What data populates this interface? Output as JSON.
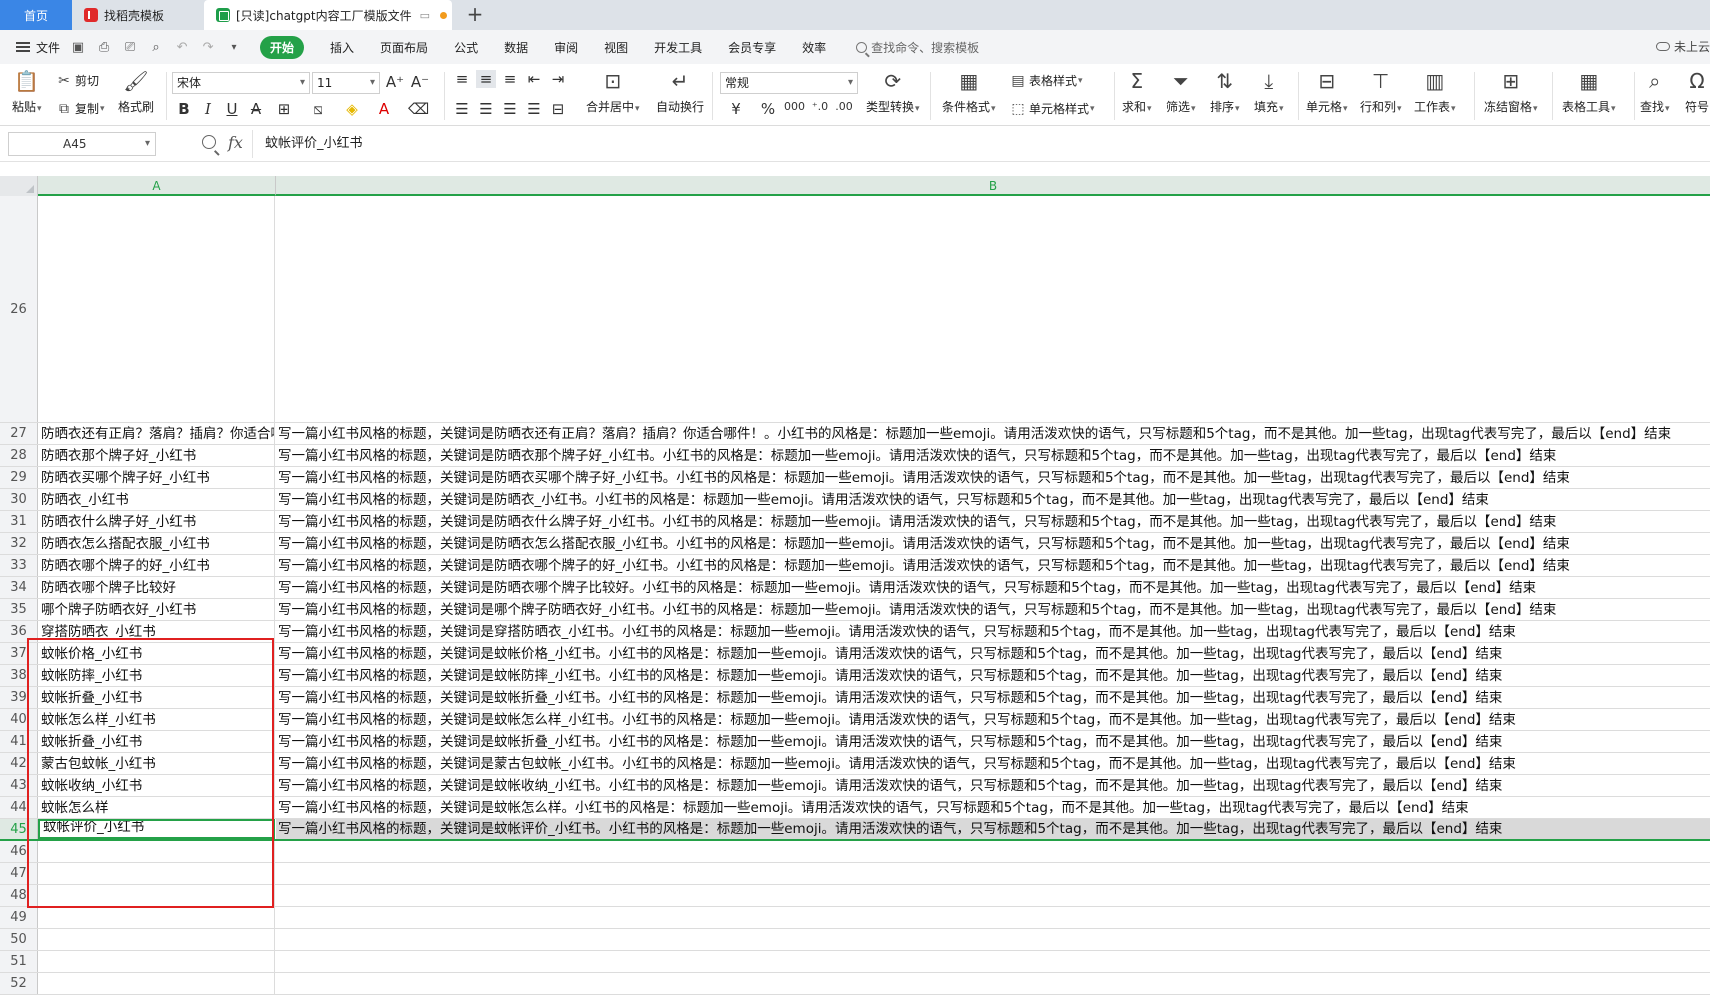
{
  "tabs": {
    "home": "首页",
    "templates": "找稻壳模板",
    "document": "[只读]chatgpt内容工厂模版文件"
  },
  "menu": {
    "file": "文件",
    "start": "开始",
    "items": [
      "插入",
      "页面布局",
      "公式",
      "数据",
      "审阅",
      "视图",
      "开发工具",
      "会员专享",
      "效率"
    ],
    "search": "查找命令、搜索模板",
    "cloud": "未上云"
  },
  "ribbon": {
    "paste": "粘贴",
    "cut": "剪切",
    "copy": "复制",
    "format_painter": "格式刷",
    "font_name": "宋体",
    "font_size": "11",
    "merge": "合并居中",
    "wrap": "自动换行",
    "number_format": "常规",
    "convert": "类型转换",
    "cond_format": "条件格式",
    "table_style": "表格样式",
    "cell_style": "单元格样式",
    "sum": "求和",
    "filter": "筛选",
    "sort": "排序",
    "fill": "填充",
    "cell": "单元格",
    "row_col": "行和列",
    "sheet": "工作表",
    "freeze": "冻结窗格",
    "table_tools": "表格工具",
    "find": "查找",
    "symbol": "符号",
    "currency": "¥",
    "percent": "%"
  },
  "formula_bar": {
    "cell_ref": "A45",
    "content": "蚊帐评价_小红书"
  },
  "columns": [
    "A",
    "B"
  ],
  "rows": [
    {
      "num": "26",
      "a": "",
      "b": ""
    },
    {
      "num": "27",
      "a": "防晒衣还有正肩？落肩？插肩？你适合哪件！_小红书",
      "b": "写一篇小红书风格的标题，关键词是防晒衣还有正肩？落肩？插肩？你适合哪件！。小红书的风格是：标题加一些emoji。请用活泼欢快的语气，只写标题和5个tag，而不是其他。加一些tag，出现tag代表写完了，最后以【end】结束"
    },
    {
      "num": "28",
      "a": "防晒衣那个牌子好_小红书",
      "b": "写一篇小红书风格的标题，关键词是防晒衣那个牌子好_小红书。小红书的风格是：标题加一些emoji。请用活泼欢快的语气，只写标题和5个tag，而不是其他。加一些tag，出现tag代表写完了，最后以【end】结束"
    },
    {
      "num": "29",
      "a": "防晒衣买哪个牌子好_小红书",
      "b": "写一篇小红书风格的标题，关键词是防晒衣买哪个牌子好_小红书。小红书的风格是：标题加一些emoji。请用活泼欢快的语气，只写标题和5个tag，而不是其他。加一些tag，出现tag代表写完了，最后以【end】结束"
    },
    {
      "num": "30",
      "a": "防晒衣_小红书",
      "b": "写一篇小红书风格的标题，关键词是防晒衣_小红书。小红书的风格是：标题加一些emoji。请用活泼欢快的语气，只写标题和5个tag，而不是其他。加一些tag，出现tag代表写完了，最后以【end】结束"
    },
    {
      "num": "31",
      "a": "防晒衣什么牌子好_小红书",
      "b": "写一篇小红书风格的标题，关键词是防晒衣什么牌子好_小红书。小红书的风格是：标题加一些emoji。请用活泼欢快的语气，只写标题和5个tag，而不是其他。加一些tag，出现tag代表写完了，最后以【end】结束"
    },
    {
      "num": "32",
      "a": "防晒衣怎么搭配衣服_小红书",
      "b": "写一篇小红书风格的标题，关键词是防晒衣怎么搭配衣服_小红书。小红书的风格是：标题加一些emoji。请用活泼欢快的语气，只写标题和5个tag，而不是其他。加一些tag，出现tag代表写完了，最后以【end】结束"
    },
    {
      "num": "33",
      "a": "防晒衣哪个牌子的好_小红书",
      "b": "写一篇小红书风格的标题，关键词是防晒衣哪个牌子的好_小红书。小红书的风格是：标题加一些emoji。请用活泼欢快的语气，只写标题和5个tag，而不是其他。加一些tag，出现tag代表写完了，最后以【end】结束"
    },
    {
      "num": "34",
      "a": "防晒衣哪个牌子比较好",
      "b": "写一篇小红书风格的标题，关键词是防晒衣哪个牌子比较好。小红书的风格是：标题加一些emoji。请用活泼欢快的语气，只写标题和5个tag，而不是其他。加一些tag，出现tag代表写完了，最后以【end】结束"
    },
    {
      "num": "35",
      "a": "哪个牌子防晒衣好_小红书",
      "b": "写一篇小红书风格的标题，关键词是哪个牌子防晒衣好_小红书。小红书的风格是：标题加一些emoji。请用活泼欢快的语气，只写标题和5个tag，而不是其他。加一些tag，出现tag代表写完了，最后以【end】结束"
    },
    {
      "num": "36",
      "a": "穿搭防晒衣_小红书",
      "b": "写一篇小红书风格的标题，关键词是穿搭防晒衣_小红书。小红书的风格是：标题加一些emoji。请用活泼欢快的语气，只写标题和5个tag，而不是其他。加一些tag，出现tag代表写完了，最后以【end】结束"
    },
    {
      "num": "37",
      "a": "蚊帐价格_小红书",
      "b": "写一篇小红书风格的标题，关键词是蚊帐价格_小红书。小红书的风格是：标题加一些emoji。请用活泼欢快的语气，只写标题和5个tag，而不是其他。加一些tag，出现tag代表写完了，最后以【end】结束"
    },
    {
      "num": "38",
      "a": "蚊帐防摔_小红书",
      "b": "写一篇小红书风格的标题，关键词是蚊帐防摔_小红书。小红书的风格是：标题加一些emoji。请用活泼欢快的语气，只写标题和5个tag，而不是其他。加一些tag，出现tag代表写完了，最后以【end】结束"
    },
    {
      "num": "39",
      "a": "蚊帐折叠_小红书",
      "b": "写一篇小红书风格的标题，关键词是蚊帐折叠_小红书。小红书的风格是：标题加一些emoji。请用活泼欢快的语气，只写标题和5个tag，而不是其他。加一些tag，出现tag代表写完了，最后以【end】结束"
    },
    {
      "num": "40",
      "a": "蚊帐怎么样_小红书",
      "b": "写一篇小红书风格的标题，关键词是蚊帐怎么样_小红书。小红书的风格是：标题加一些emoji。请用活泼欢快的语气，只写标题和5个tag，而不是其他。加一些tag，出现tag代表写完了，最后以【end】结束"
    },
    {
      "num": "41",
      "a": "蚊帐折叠_小红书",
      "b": "写一篇小红书风格的标题，关键词是蚊帐折叠_小红书。小红书的风格是：标题加一些emoji。请用活泼欢快的语气，只写标题和5个tag，而不是其他。加一些tag，出现tag代表写完了，最后以【end】结束"
    },
    {
      "num": "42",
      "a": "蒙古包蚊帐_小红书",
      "b": "写一篇小红书风格的标题，关键词是蒙古包蚊帐_小红书。小红书的风格是：标题加一些emoji。请用活泼欢快的语气，只写标题和5个tag，而不是其他。加一些tag，出现tag代表写完了，最后以【end】结束"
    },
    {
      "num": "43",
      "a": "蚊帐收纳_小红书",
      "b": "写一篇小红书风格的标题，关键词是蚊帐收纳_小红书。小红书的风格是：标题加一些emoji。请用活泼欢快的语气，只写标题和5个tag，而不是其他。加一些tag，出现tag代表写完了，最后以【end】结束"
    },
    {
      "num": "44",
      "a": "蚊帐怎么样",
      "b": "写一篇小红书风格的标题，关键词是蚊帐怎么样。小红书的风格是：标题加一些emoji。请用活泼欢快的语气，只写标题和5个tag，而不是其他。加一些tag，出现tag代表写完了，最后以【end】结束"
    },
    {
      "num": "45",
      "a": "蚊帐评价_小红书",
      "b": "写一篇小红书风格的标题，关键词是蚊帐评价_小红书。小红书的风格是：标题加一些emoji。请用活泼欢快的语气，只写标题和5个tag，而不是其他。加一些tag，出现tag代表写完了，最后以【end】结束"
    },
    {
      "num": "46",
      "a": "",
      "b": ""
    },
    {
      "num": "47",
      "a": "",
      "b": ""
    },
    {
      "num": "48",
      "a": "",
      "b": ""
    },
    {
      "num": "49",
      "a": "",
      "b": ""
    },
    {
      "num": "50",
      "a": "",
      "b": ""
    },
    {
      "num": "51",
      "a": "",
      "b": ""
    },
    {
      "num": "52",
      "a": "",
      "b": ""
    }
  ]
}
